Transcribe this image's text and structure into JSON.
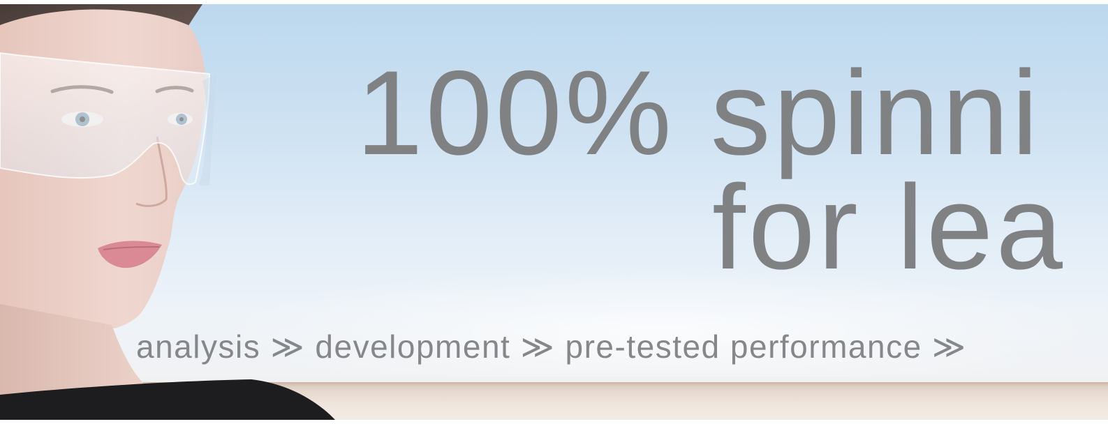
{
  "banner": {
    "headline_line1": "100% spinni",
    "headline_line2": "for lea",
    "tagline": "analysis ≫ development ≫ pre-tested performance ≫"
  },
  "image": {
    "subject": "woman-with-visor-portrait"
  },
  "colors": {
    "sky_top": "#bcd8ee",
    "sky_bottom": "#f0f2f4",
    "text": "#7f8183"
  }
}
